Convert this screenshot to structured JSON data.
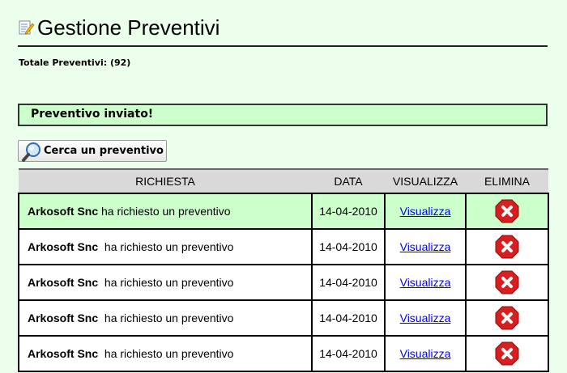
{
  "header": {
    "title": "Gestione Preventivi"
  },
  "summary": {
    "total_label": "Totale Preventivi: (92)"
  },
  "notice": {
    "message": "Preventivo inviato!"
  },
  "search_button": {
    "label": "Cerca un preventivo"
  },
  "table": {
    "columns": [
      "RICHIESTA",
      "DATA",
      "VISUALIZZA",
      "ELIMINA"
    ],
    "rows": [
      {
        "company": "Arkosoft Snc",
        "text": "ha richiesto un preventivo",
        "date": "14-04-2010",
        "view_label": "Visualizza"
      },
      {
        "company": "Arkosoft Snc",
        "text": "ha richiesto un preventivo",
        "date": "14-04-2010",
        "view_label": "Visualizza"
      },
      {
        "company": "Arkosoft Snc",
        "text": "ha richiesto un preventivo",
        "date": "14-04-2010",
        "view_label": "Visualizza"
      },
      {
        "company": "Arkosoft Snc",
        "text": "ha richiesto un preventivo",
        "date": "14-04-2010",
        "view_label": "Visualizza"
      },
      {
        "company": "Arkosoft Snc",
        "text": "ha richiesto un preventivo",
        "date": "14-04-2010",
        "view_label": "Visualizza"
      }
    ]
  },
  "icons": {
    "title": "notepad-pencil-icon",
    "search": "magnifier-icon",
    "delete": "delete-x-icon"
  },
  "colors": {
    "background": "#ecfeec",
    "highlight": "#ccffcc",
    "header_bg": "#d9d9d9",
    "link": "#0000ee",
    "delete_red": "#d81e1e"
  }
}
